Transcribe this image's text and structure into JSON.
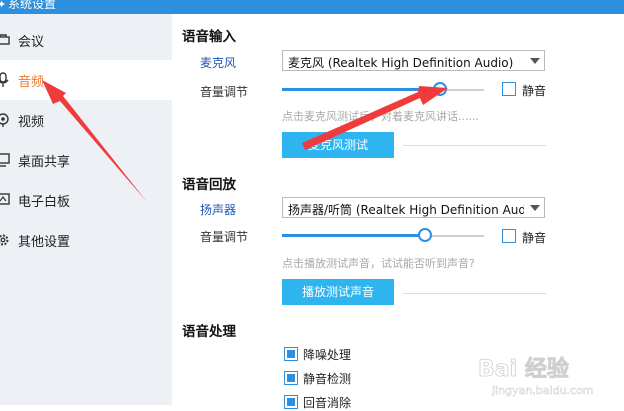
{
  "window": {
    "title": "系统设置"
  },
  "sidebar": {
    "items": [
      {
        "label": "会议",
        "icon": "meeting-icon"
      },
      {
        "label": "音频",
        "icon": "microphone-icon",
        "active": true
      },
      {
        "label": "视频",
        "icon": "video-icon"
      },
      {
        "label": "桌面共享",
        "icon": "screen-share-icon"
      },
      {
        "label": "电子白板",
        "icon": "whiteboard-icon"
      },
      {
        "label": "其他设置",
        "icon": "gear-icon"
      }
    ]
  },
  "audio_input": {
    "title": "语音输入",
    "device_label": "麦克风",
    "device_value": "麦克风 (Realtek High Definition Audio)",
    "volume_label": "音量调节",
    "volume_level": 0.78,
    "mute_label": "静音",
    "mute_checked": false,
    "hint": "点击麦克风测试后，对着麦克风讲话......",
    "test_button": "麦克风测试"
  },
  "audio_output": {
    "title": "语音回放",
    "device_label": "扬声器",
    "device_value": "扬声器/听筒 (Realtek High Definition Audio)",
    "volume_label": "音量调节",
    "volume_level": 0.71,
    "mute_label": "静音",
    "mute_checked": false,
    "hint": "点击播放测试声音，试试能否听到声音?",
    "test_button": "播放测试声音"
  },
  "audio_processing": {
    "title": "语音处理",
    "options": [
      {
        "label": "降噪处理",
        "checked": true
      },
      {
        "label": "静音检测",
        "checked": true
      },
      {
        "label": "回音消除",
        "checked": true
      }
    ]
  },
  "colors": {
    "accent": "#2d8fdd",
    "active_text": "#f07a2a",
    "annotation_arrow": "#ef3b3b",
    "button": "#2eb5ef"
  },
  "watermark": {
    "brand": "Bai 经验",
    "url": "jingyan.baidu.com"
  }
}
